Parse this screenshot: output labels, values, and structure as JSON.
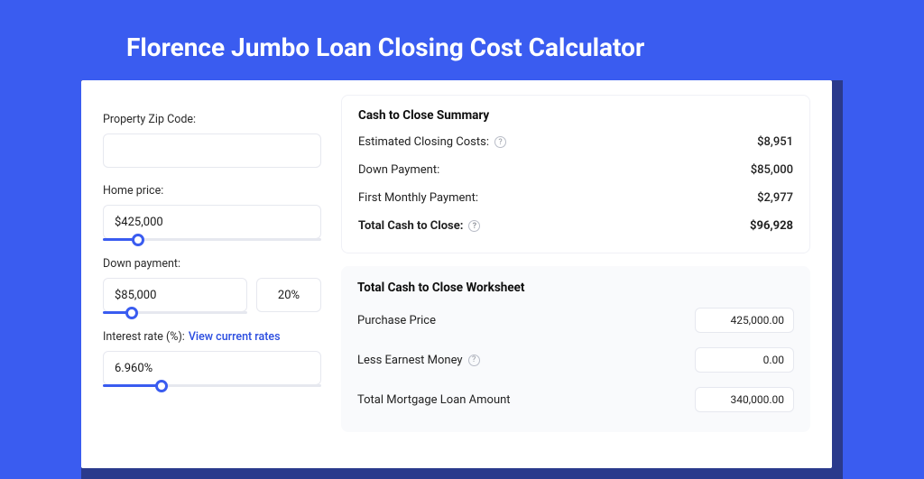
{
  "title": "Florence Jumbo Loan Closing Cost Calculator",
  "left": {
    "zip_label": "Property Zip Code:",
    "zip_value": "",
    "home_price_label": "Home price:",
    "home_price_value": "$425,000",
    "home_price_slider_pct": 16,
    "down_payment_label": "Down payment:",
    "down_payment_value": "$85,000",
    "down_payment_pct_display": "20%",
    "down_payment_slider_pct": 20,
    "interest_label": "Interest rate (%):",
    "interest_link": "View current rates",
    "interest_value": "6.960%",
    "interest_slider_pct": 27
  },
  "summary": {
    "title": "Cash to Close Summary",
    "rows": [
      {
        "label": "Estimated Closing Costs:",
        "help": true,
        "value": "$8,951",
        "bold": false
      },
      {
        "label": "Down Payment:",
        "help": false,
        "value": "$85,000",
        "bold": false
      },
      {
        "label": "First Monthly Payment:",
        "help": false,
        "value": "$2,977",
        "bold": false
      },
      {
        "label": "Total Cash to Close:",
        "help": true,
        "value": "$96,928",
        "bold": true
      }
    ]
  },
  "worksheet": {
    "title": "Total Cash to Close Worksheet",
    "rows": [
      {
        "label": "Purchase Price",
        "help": false,
        "value": "425,000.00"
      },
      {
        "label": "Less Earnest Money",
        "help": true,
        "value": "0.00"
      },
      {
        "label": "Total Mortgage Loan Amount",
        "help": false,
        "value": "340,000.00"
      }
    ]
  }
}
